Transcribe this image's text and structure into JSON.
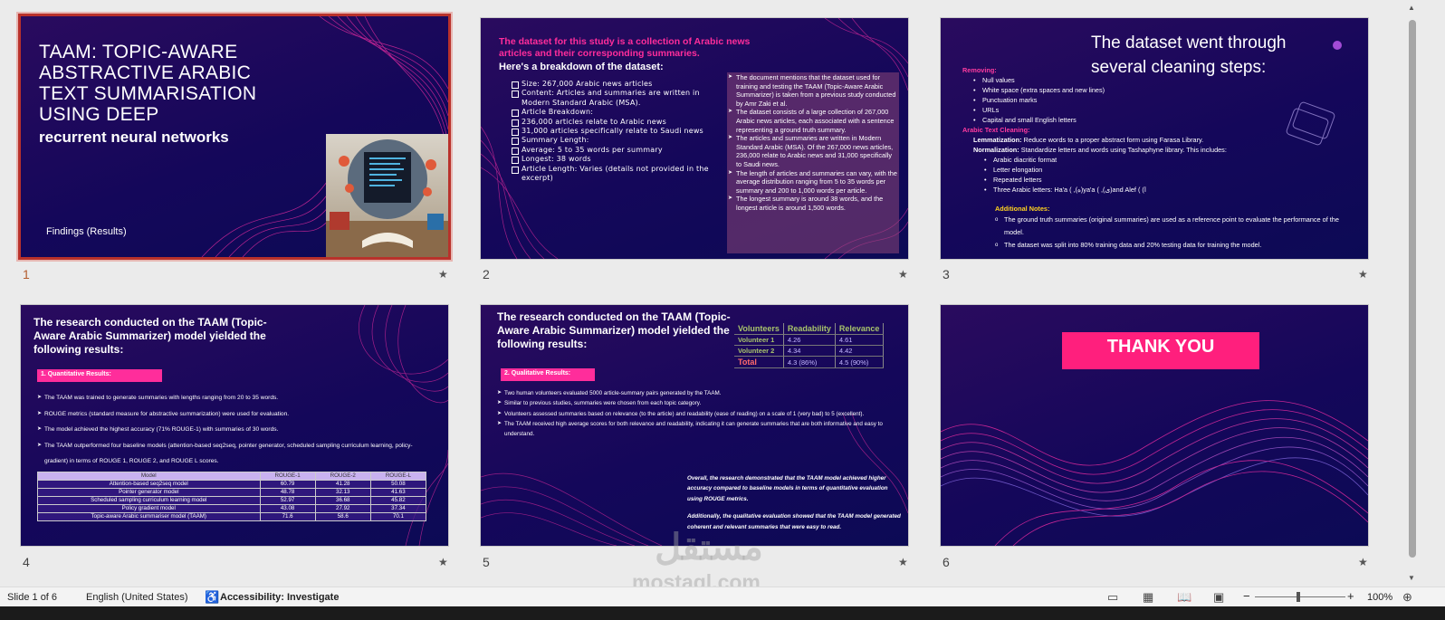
{
  "slides": [
    {
      "number": "1",
      "title": "TAAM: TOPIC-AWARE ABSTRACTIVE ARABIC TEXT SUMMARISATION USING DEEP",
      "subtitle": "recurrent neural networks",
      "footer": "Findings (Results)"
    },
    {
      "number": "2",
      "heading": "The dataset for this study is a collection of Arabic news articles and their corresponding summaries.",
      "subheading": "Here's a breakdown of the dataset:",
      "items": [
        "Size: 267,000 Arabic news articles",
        "Content: Articles and summaries are written in Modern Standard Arabic (MSA).",
        "Article Breakdown:",
        "236,000 articles relate to Arabic news",
        "31,000 articles specifically relate to Saudi news",
        "Summary Length:",
        "Average: 5 to 35 words per summary",
        "Longest: 38 words",
        "Article Length: Varies (details not provided in the excerpt)"
      ],
      "notes": [
        "The document mentions that the dataset used for training and testing the TAAM (Topic-Aware Arabic Summarizer) is taken from a previous study conducted by Amr Zaki et al.",
        "The dataset consists of a large collection of 267,000 Arabic news articles, each associated with a sentence representing a ground truth summary.",
        "The articles and summaries are written in Modern Standard Arabic (MSA). Of the 267,000 news articles, 236,000 relate to Arabic news and 31,000 specifically to Saudi news.",
        "The length of articles and summaries can vary, with the average distribution ranging from 5 to 35 words per summary and 200 to 1,000 words per article.",
        "The longest summary is around 38 words, and the longest article is around 1,500 words."
      ]
    },
    {
      "number": "3",
      "title": "The dataset went through several cleaning steps:",
      "removing_label": "Removing:",
      "removing_items": [
        "Null values",
        "White space (extra spaces and new lines)",
        "Punctuation marks",
        "URLs",
        "Capital and small English letters"
      ],
      "cleaning_label": "Arabic Text Cleaning:",
      "lemmatization_label": "Lemmatization:",
      "lemmatization_text": "Reduce words to a proper abstract form using Farasa Library.",
      "normalization_label": "Normalization:",
      "normalization_text": "Standardize letters and words using Tashaphyne library. This includes:",
      "normalization_items": [
        "Arabic diacritic format",
        "Letter elongation",
        "Repeated letters",
        "Three Arabic letters: Ha'a ( ,(ه)ya'a ( ,(ى)and Alef ( (ا"
      ],
      "notes_label": "Additional Notes:",
      "notes_items": [
        "The ground truth summaries (original summaries) are used as a reference point to evaluate the performance of the model.",
        "The dataset was split into 80% training data and 20% testing data for training the model."
      ]
    },
    {
      "number": "4",
      "title": "The research conducted on the TAAM (Topic-Aware Arabic Summarizer) model yielded the following results:",
      "tag": "1.   Quantitative Results:",
      "bullets": [
        "The TAAM was trained to generate summaries with lengths ranging from 20 to 35 words.",
        "ROUGE metrics (standard measure for abstractive summarization) were used for evaluation.",
        "The model achieved the highest accuracy (71% ROUGE-1) with summaries of 30 words.",
        "The TAAM outperformed four baseline models (attention-based seq2seq, pointer generator, scheduled sampling curriculum learning, policy-gradient) in terms of ROUGE 1, ROUGE 2, and ROUGE L scores."
      ],
      "table_headers": [
        "Model",
        "ROUGE-1",
        "ROUGE-2",
        "ROUGE-L"
      ],
      "table_rows": [
        [
          "Attention-based seq2seq model",
          "60.79",
          "41.28",
          "50.08"
        ],
        [
          "Pointer generator model",
          "48.78",
          "32.13",
          "41.63"
        ],
        [
          "Scheduled sampling curriculum learning model",
          "52.97",
          "36.68",
          "45.82"
        ],
        [
          "Policy gradient model",
          "43.08",
          "27.92",
          "37.34"
        ],
        [
          "Topic-aware Arabic summariser model (TAAM)",
          "71.6",
          "58.6",
          "70.1"
        ]
      ]
    },
    {
      "number": "5",
      "title": "The research conducted on the TAAM (Topic-Aware Arabic Summarizer) model yielded the following results:",
      "table_headers": [
        "Volunteers",
        "Readability",
        "Relevance"
      ],
      "table_rows": [
        [
          "Volunteer 1",
          "4.26",
          "4.61"
        ],
        [
          "Volunteer 2",
          "4.34",
          "4.42"
        ],
        [
          "Total",
          "4.3 (86%)",
          "4.5 (90%)"
        ]
      ],
      "tag": "2. Qualitative Results:",
      "bullets": [
        "Two human volunteers evaluated 5000 article-summary pairs generated by the TAAM.",
        "Similar to previous studies, summaries were chosen from each topic category.",
        "Volunteers assessed summaries based on relevance (to the article) and readability (ease of reading) on a scale of 1 (very bad) to 5 (excellent).",
        "The TAAM received high average scores for both relevance and readability, indicating it can generate summaries that are both informative and easy to understand."
      ],
      "conclusion_1": "Overall, the research demonstrated that the TAAM model achieved higher accuracy compared to baseline models in terms of quantitative evaluation using ROUGE metrics.",
      "conclusion_2": "Additionally, the qualitative evaluation showed that the TAAM model generated coherent and relevant summaries that were easy to read."
    },
    {
      "number": "6",
      "button": "THANK YOU"
    }
  ],
  "watermark": {
    "arabic": "مستقل",
    "latin": "mostaql.com"
  },
  "status": {
    "slide_info": "Slide 1 of 6",
    "language": "English (United States)",
    "accessibility": "Accessibility: Investigate",
    "zoom": "100%"
  },
  "icons": [
    "star-icon",
    "accessibility-icon",
    "normal-view-icon",
    "slide-sorter-icon",
    "reading-view-icon",
    "slideshow-icon",
    "fit-window-icon"
  ],
  "colors": {
    "accent_pink": "#ff2d9b",
    "selection": "#b9312b",
    "slide_bg": "#14075a"
  }
}
